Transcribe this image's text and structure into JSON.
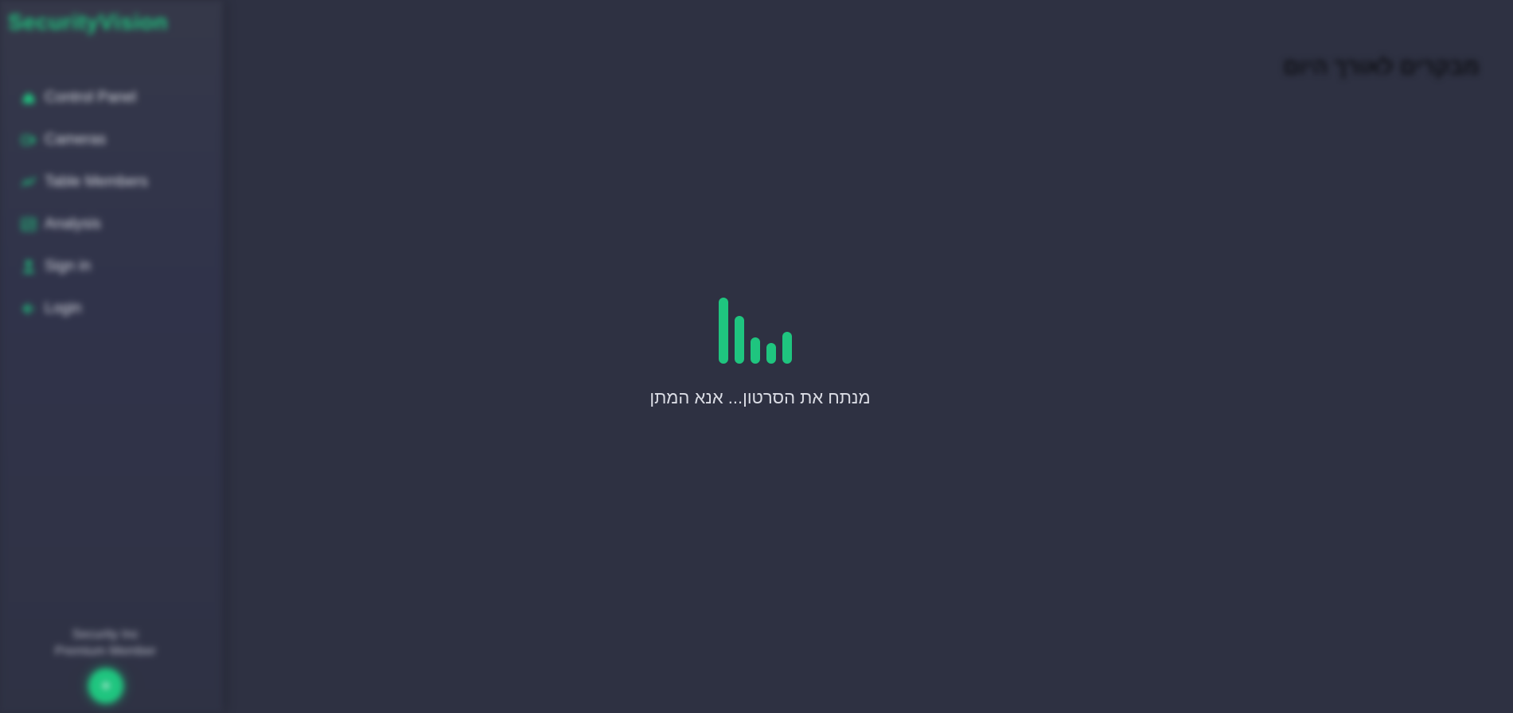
{
  "sidebar": {
    "brand": "SecurityVision",
    "items": [
      {
        "label": "Control Panel",
        "icon": "home-icon"
      },
      {
        "label": "Cameras",
        "icon": "camera-icon"
      },
      {
        "label": "Table Members",
        "icon": "chart-icon"
      },
      {
        "label": "Analysis",
        "icon": "analysis-icon"
      },
      {
        "label": "Sign in",
        "icon": "user-icon"
      },
      {
        "label": "Login",
        "icon": "login-icon"
      }
    ],
    "footer": {
      "company": "Security Inc",
      "membership": "Premium Member",
      "avatar_symbol": "+"
    }
  },
  "main": {
    "title": "מבקרים לאורך היום"
  },
  "loading": {
    "message": "מנתח את הסרטון... אנא המתן",
    "accent_color": "#1fc57f"
  }
}
